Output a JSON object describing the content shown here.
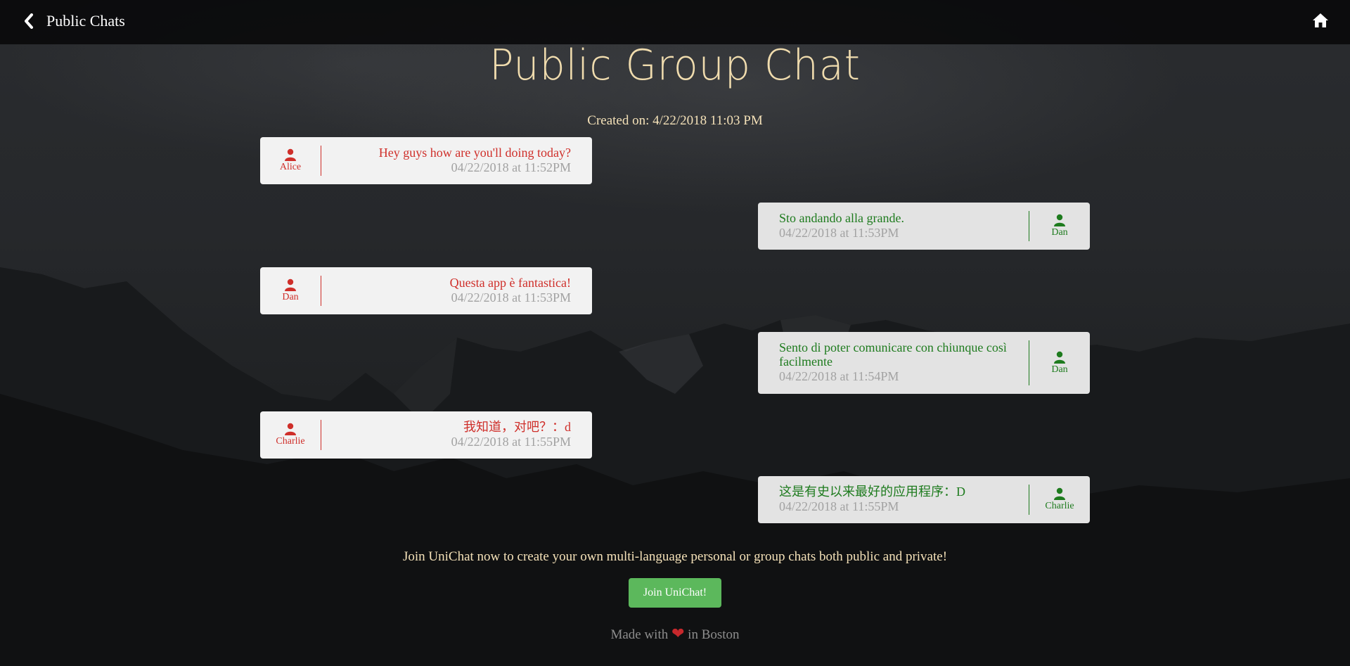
{
  "nav": {
    "back_label": "Public Chats"
  },
  "page": {
    "title": "Public Group Chat",
    "created": "Created on: 4/22/2018 11:03 PM"
  },
  "messages": [
    {
      "side": "left",
      "sender": "Alice",
      "text": "Hey guys how are you'll doing today?",
      "time": "04/22/2018 at 11:52PM"
    },
    {
      "side": "right",
      "sender": "Dan",
      "text": "Sto andando alla grande.",
      "time": "04/22/2018 at 11:53PM"
    },
    {
      "side": "left",
      "sender": "Dan",
      "text": "Questa app è fantastica!",
      "time": "04/22/2018 at 11:53PM"
    },
    {
      "side": "right",
      "sender": "Dan",
      "text": "Sento di poter comunicare con chiunque così facilmente",
      "time": "04/22/2018 at 11:54PM"
    },
    {
      "side": "left",
      "sender": "Charlie",
      "text": "我知道，对吧？：d",
      "time": "04/22/2018 at 11:55PM"
    },
    {
      "side": "right",
      "sender": "Charlie",
      "text": "这是有史以来最好的应用程序：D",
      "time": "04/22/2018 at 11:55PM"
    }
  ],
  "join": {
    "text": "Join UniChat now to create your own multi-language personal or group chats both public and private!",
    "button_label": "Join UniChat!"
  },
  "footer": {
    "prefix": "Made with",
    "heart_icon": "heart-icon",
    "suffix": "in Boston"
  },
  "colors": {
    "left_message_text": "#cf2f2a",
    "right_message_text": "#1e7b1e",
    "join_button": "#5cb85c",
    "title": "#f0dcae"
  }
}
